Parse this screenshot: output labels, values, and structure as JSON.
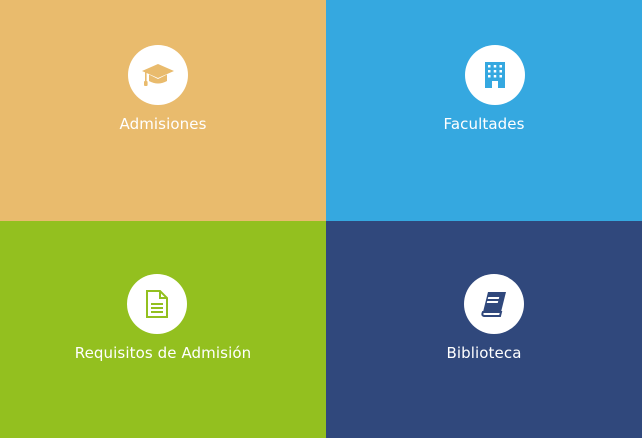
{
  "tiles": [
    {
      "id": "admisiones",
      "label": "Admisiones",
      "icon": "graduation-cap-icon",
      "color": "#e9bb6d"
    },
    {
      "id": "facultades",
      "label": "Facultades",
      "icon": "building-icon",
      "color": "#35a8e0"
    },
    {
      "id": "requisitos",
      "label": "Requisitos de Admisión",
      "icon": "document-icon",
      "color": "#93c01f"
    },
    {
      "id": "biblioteca",
      "label": "Biblioteca",
      "icon": "book-icon",
      "color": "#30487c"
    }
  ]
}
